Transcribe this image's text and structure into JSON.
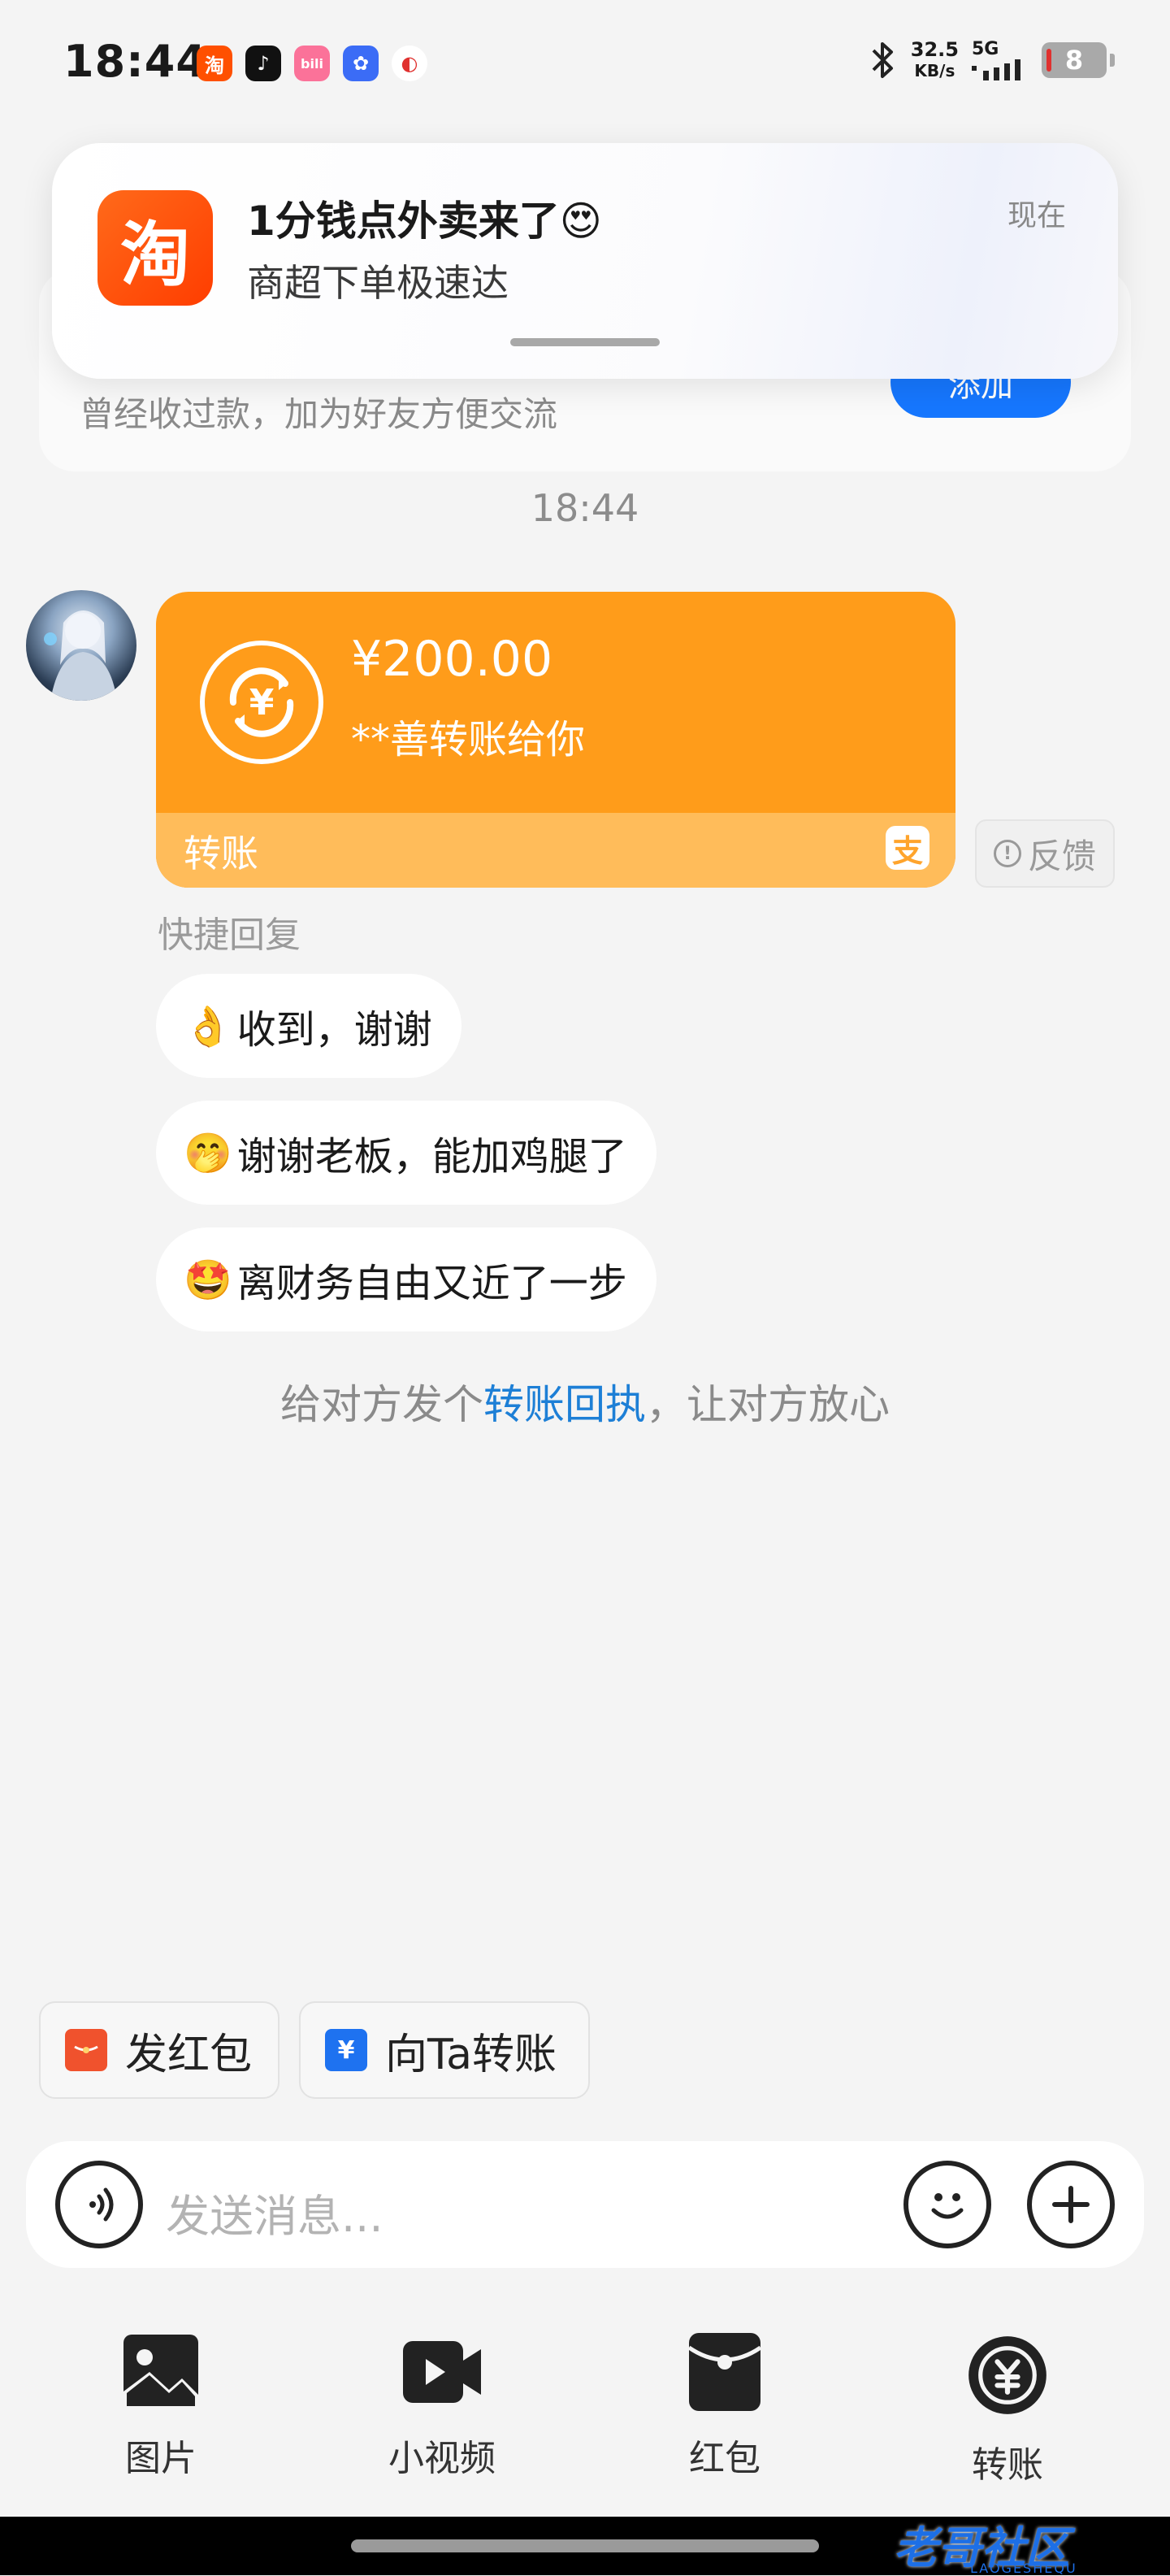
{
  "status_bar": {
    "time": "18:44",
    "notification_apps": [
      {
        "glyph": "淘",
        "color": "#ff5000"
      },
      {
        "glyph": "♪",
        "color": "#111111"
      },
      {
        "glyph": "bili",
        "color": "#fb7299"
      },
      {
        "glyph": "✿",
        "color": "#3b6cf6"
      },
      {
        "glyph": "◐",
        "color": "#e0312f"
      }
    ],
    "net_speed_value": "32.5",
    "net_speed_unit": "KB/s",
    "network": "5G",
    "battery": "8"
  },
  "notification": {
    "app_glyph": "淘",
    "title": "1分钱点外卖来了",
    "title_emoji": "😍",
    "subtitle": "商超下单极速达",
    "time": "现在"
  },
  "friend_card": {
    "description": "曾经收过款，加为好友方便交流",
    "add_button": "添加"
  },
  "chat": {
    "timestamp": "18:44",
    "transfer": {
      "amount": "¥200.00",
      "description": "**善转账给你",
      "label": "转账",
      "alipay_glyph": "支",
      "currency_glyph": "¥"
    },
    "feedback": "反馈",
    "quick_reply_title": "快捷回复",
    "quick_replies": [
      {
        "emoji": "👌",
        "text": "收到，谢谢"
      },
      {
        "emoji": "🤭",
        "text": "谢谢老板，能加鸡腿了"
      },
      {
        "emoji": "🤩",
        "text": "离财务自由又近了一步"
      }
    ],
    "receipt_prefix": "给对方发个",
    "receipt_link": "转账回执",
    "receipt_suffix": "，让对方放心"
  },
  "quick_actions": [
    {
      "label": "发红包",
      "glyph": "▬",
      "color": "#f0522d"
    },
    {
      "label": "向Ta转账",
      "glyph": "¥",
      "color": "#1e72f0"
    }
  ],
  "input": {
    "placeholder": "发送消息..."
  },
  "toolbar": [
    {
      "label": "图片"
    },
    {
      "label": "小视频"
    },
    {
      "label": "红包"
    },
    {
      "label": "转账"
    }
  ],
  "watermark": {
    "text": "老哥社区",
    "sub": "LAOGESHEQU"
  }
}
